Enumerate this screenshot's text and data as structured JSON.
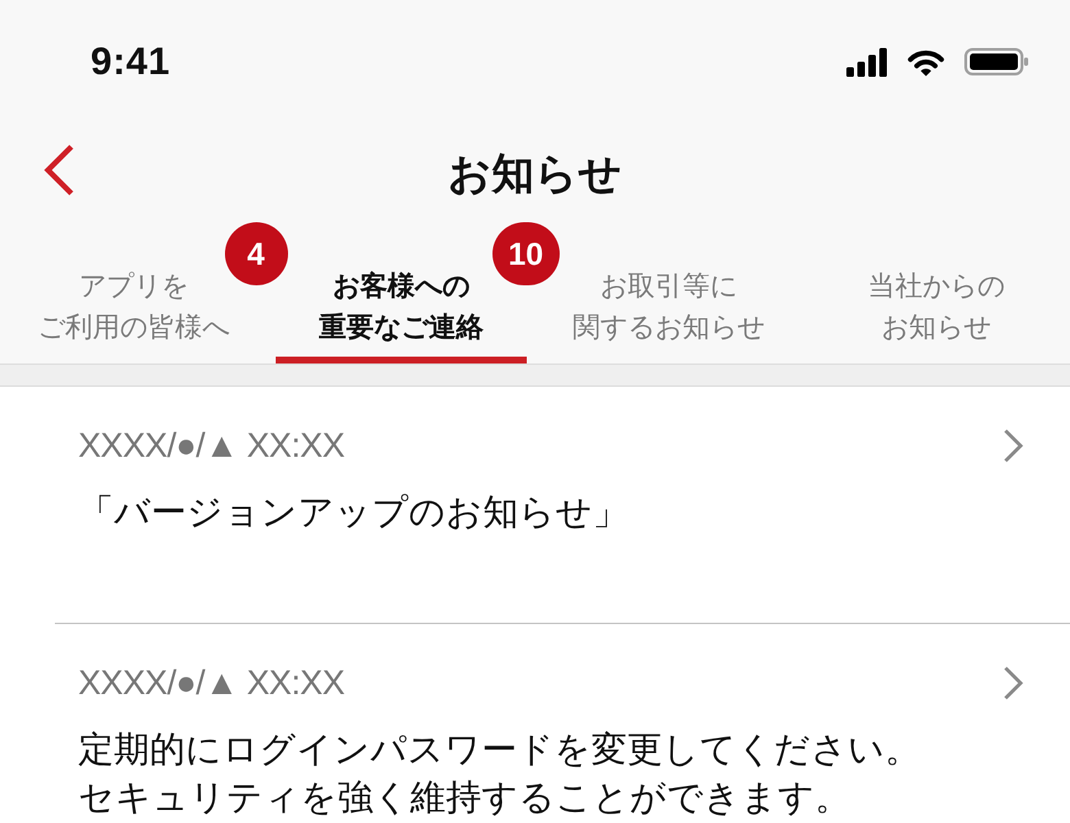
{
  "status_bar": {
    "time": "9:41"
  },
  "nav_bar": {
    "title": "お知らせ"
  },
  "tabs": [
    {
      "label_lines": [
        "アプリを",
        "ご利用の皆様へ"
      ],
      "selected": false,
      "badge": "4"
    },
    {
      "label_lines": [
        "お客様への",
        "重要なご連絡"
      ],
      "selected": true,
      "badge": "10"
    },
    {
      "label_lines": [
        "お取引等に",
        "関するお知らせ"
      ],
      "selected": false
    },
    {
      "label_lines": [
        "当社からの",
        "お知らせ"
      ],
      "selected": false
    }
  ],
  "notices": [
    {
      "date": "XXXX/●/▲ XX:XX",
      "title_lines": [
        "「バージョンアップのお知らせ」"
      ]
    },
    {
      "date": "XXXX/●/▲ XX:XX",
      "title_lines": [
        "定期的にログインパスワードを変更してください。",
        "セキュリティを強く維持することができます。"
      ]
    }
  ]
}
